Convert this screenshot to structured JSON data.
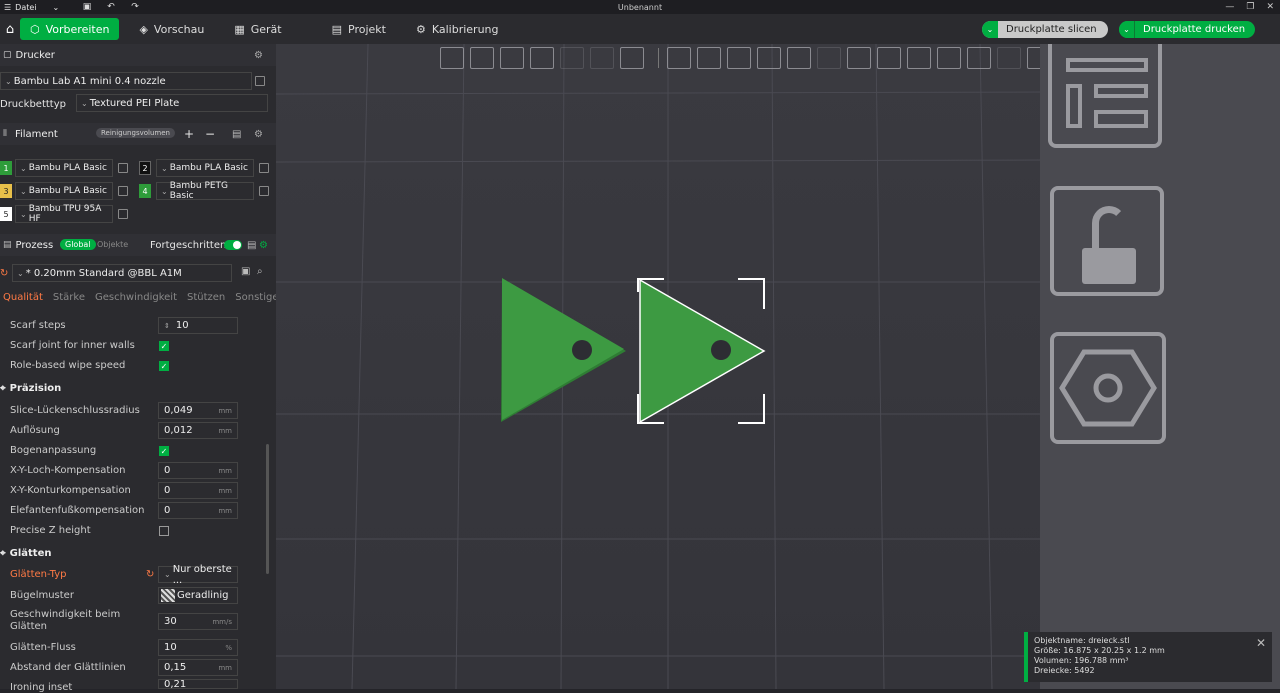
{
  "titlebar": {
    "menu_label": "Datei",
    "title": "Unbenannt"
  },
  "nav": {
    "tabs": [
      {
        "label": "Vorbereiten",
        "active": true
      },
      {
        "label": "Vorschau",
        "active": false
      },
      {
        "label": "Gerät",
        "active": false
      },
      {
        "label": "Projekt",
        "active": false
      },
      {
        "label": "Kalibrierung",
        "active": false
      }
    ],
    "slice_label": "Druckplatte slicen",
    "print_label": "Druckplatte drucken"
  },
  "printer": {
    "section_label": "Drucker",
    "printer_name": "Bambu Lab A1 mini 0.4 nozzle",
    "bed_label": "Druckbetttyp",
    "bed_value": "Textured PEI Plate"
  },
  "filament": {
    "section_label": "Filament",
    "flush_label": "Reinigungsvolumen",
    "slots": [
      {
        "num": "1",
        "name": "Bambu PLA Basic",
        "color": "#2e9c3a"
      },
      {
        "num": "2",
        "name": "Bambu PLA Basic",
        "color": "#111111"
      },
      {
        "num": "3",
        "name": "Bambu PLA Basic",
        "color": "#e8c04a"
      },
      {
        "num": "4",
        "name": "Bambu PETG Basic",
        "color": "#2e9c3a"
      },
      {
        "num": "5",
        "name": "Bambu TPU 95A HF",
        "color": "#ffffff"
      }
    ]
  },
  "process": {
    "section_label": "Prozess",
    "global_label": "Global",
    "objects_label": "Objekte",
    "advanced_label": "Fortgeschritten",
    "profile": "* 0.20mm Standard @BBL A1M",
    "tabs": [
      "Qualität",
      "Stärke",
      "Geschwindigkeit",
      "Stützen",
      "Sonstige"
    ]
  },
  "params": {
    "scarf_steps": {
      "label": "Scarf steps",
      "value": "10"
    },
    "scarf_inner": {
      "label": "Scarf joint for inner walls"
    },
    "role_wipe": {
      "label": "Role-based wipe speed"
    },
    "precision_title": "Präzision",
    "slice_gap": {
      "label": "Slice-Lückenschlussradius",
      "value": "0,049",
      "unit": "mm"
    },
    "resolution": {
      "label": "Auflösung",
      "value": "0,012",
      "unit": "mm"
    },
    "arc": {
      "label": "Bogenanpassung"
    },
    "xy_hole": {
      "label": "X-Y-Loch-Kompensation",
      "value": "0",
      "unit": "mm"
    },
    "xy_contour": {
      "label": "X-Y-Konturkompensation",
      "value": "0",
      "unit": "mm"
    },
    "elephant": {
      "label": "Elefantenfußkompensation",
      "value": "0",
      "unit": "mm"
    },
    "precise_z": {
      "label": "Precise Z height"
    },
    "ironing_title": "Glätten",
    "ironing_type": {
      "label": "Glätten-Typ",
      "value": "Nur oberste ..."
    },
    "ironing_pattern": {
      "label": "Bügelmuster",
      "value": "Geradlinig"
    },
    "ironing_speed": {
      "label": "Geschwindigkeit beim Glätten",
      "value": "30",
      "unit": "mm/s"
    },
    "ironing_flow": {
      "label": "Glätten-Fluss",
      "value": "10",
      "unit": "%"
    },
    "ironing_spacing": {
      "label": "Abstand der Glättlinien",
      "value": "0,15",
      "unit": "mm"
    },
    "ironing_inset": {
      "label": "Ironing inset",
      "value": "0,21"
    }
  },
  "info": {
    "object_name": "Objektname: dreieck.stl",
    "size": "Größe: 16.875 x 20.25 x 1.2 mm",
    "volume": "Volumen: 196.788 mm³",
    "triangles": "Dreiecke: 5492"
  },
  "colors": {
    "accent": "#00ae42",
    "model": "#3d9a42",
    "warning": "#ff7a45"
  }
}
